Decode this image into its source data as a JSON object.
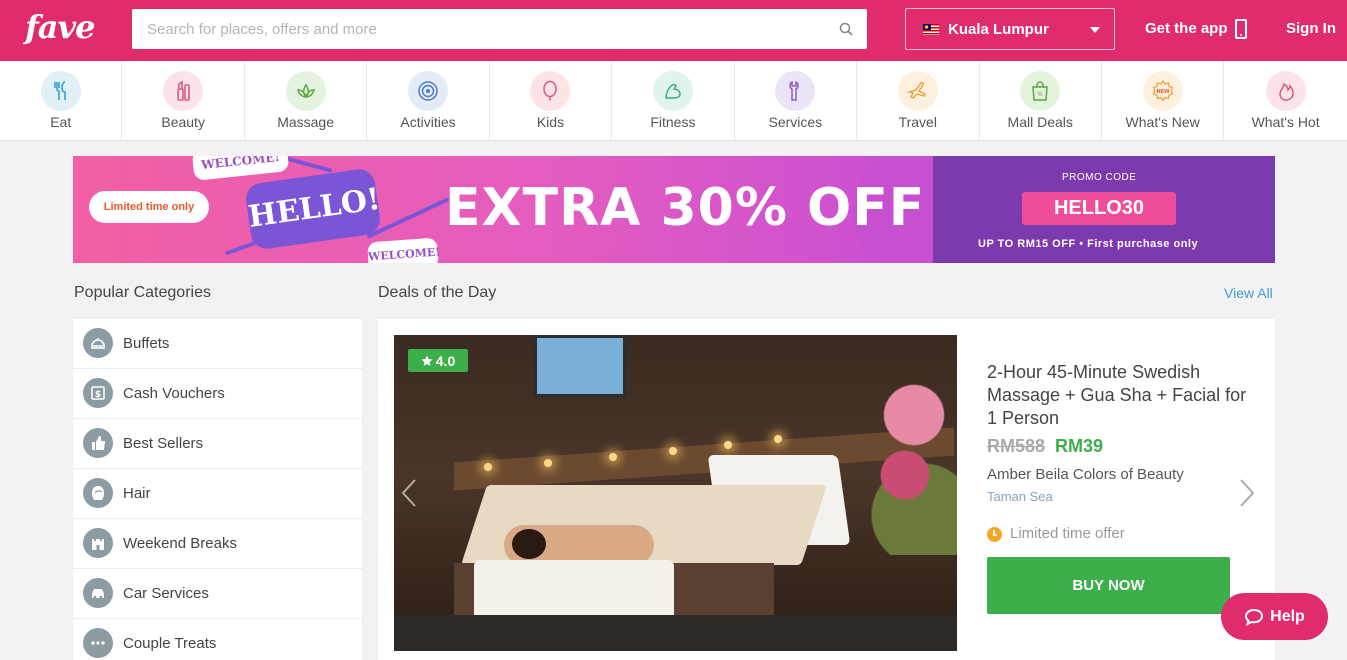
{
  "header": {
    "logo": "fave",
    "search_placeholder": "Search for places, offers and more",
    "city": "Kuala Lumpur",
    "get_app": "Get the app",
    "sign_in": "Sign In",
    "brand_color": "#e02c6d"
  },
  "categories": [
    {
      "label": "Eat",
      "icon": "utensils-icon",
      "color": "#dff1f7"
    },
    {
      "label": "Beauty",
      "icon": "lipstick-icon",
      "color": "#fbe3ea"
    },
    {
      "label": "Massage",
      "icon": "lotus-icon",
      "color": "#e4f3df"
    },
    {
      "label": "Activities",
      "icon": "target-icon",
      "color": "#e3ebf6"
    },
    {
      "label": "Kids",
      "icon": "balloon-icon",
      "color": "#fbe3e6"
    },
    {
      "label": "Fitness",
      "icon": "bicep-icon",
      "color": "#dff4ec"
    },
    {
      "label": "Services",
      "icon": "wrench-icon",
      "color": "#ebe4f6"
    },
    {
      "label": "Travel",
      "icon": "airplane-icon",
      "color": "#fdf0df"
    },
    {
      "label": "Mall Deals",
      "icon": "shopping-bag-icon",
      "color": "#e3f3de"
    },
    {
      "label": "What's New",
      "icon": "new-badge-icon",
      "color": "#fdf0df"
    },
    {
      "label": "What's Hot",
      "icon": "flame-icon",
      "color": "#fbe3ea"
    }
  ],
  "banner": {
    "limited": "Limited time only",
    "welcome1": "WELCOME!",
    "hello": "HELLO!",
    "welcome2": "WELCOME!",
    "offer": "EXTRA 30% OFF",
    "promo_label": "PROMO CODE",
    "promo_code": "HELLO30",
    "promo_sub": "UP TO RM15 OFF • First purchase only"
  },
  "popular": {
    "title": "Popular Categories",
    "items": [
      {
        "label": "Buffets",
        "icon": "buffet-icon"
      },
      {
        "label": "Cash Vouchers",
        "icon": "dollar-voucher-icon"
      },
      {
        "label": "Best Sellers",
        "icon": "thumbs-up-icon"
      },
      {
        "label": "Hair",
        "icon": "hair-icon"
      },
      {
        "label": "Weekend Breaks",
        "icon": "castle-icon"
      },
      {
        "label": "Car Services",
        "icon": "car-icon"
      },
      {
        "label": "Couple Treats",
        "icon": "more-dots-icon"
      }
    ]
  },
  "deals": {
    "title": "Deals of the Day",
    "view_all": "View All",
    "card": {
      "rating": "4.0",
      "title": "2-Hour 45-Minute Swedish Massage + Gua Sha + Facial for 1 Person",
      "old_price": "RM588",
      "new_price": "RM39",
      "merchant": "Amber Beila Colors of Beauty",
      "area": "Taman Sea",
      "limited": "Limited time offer",
      "buy": "BUY NOW"
    }
  },
  "help": {
    "label": "Help"
  }
}
